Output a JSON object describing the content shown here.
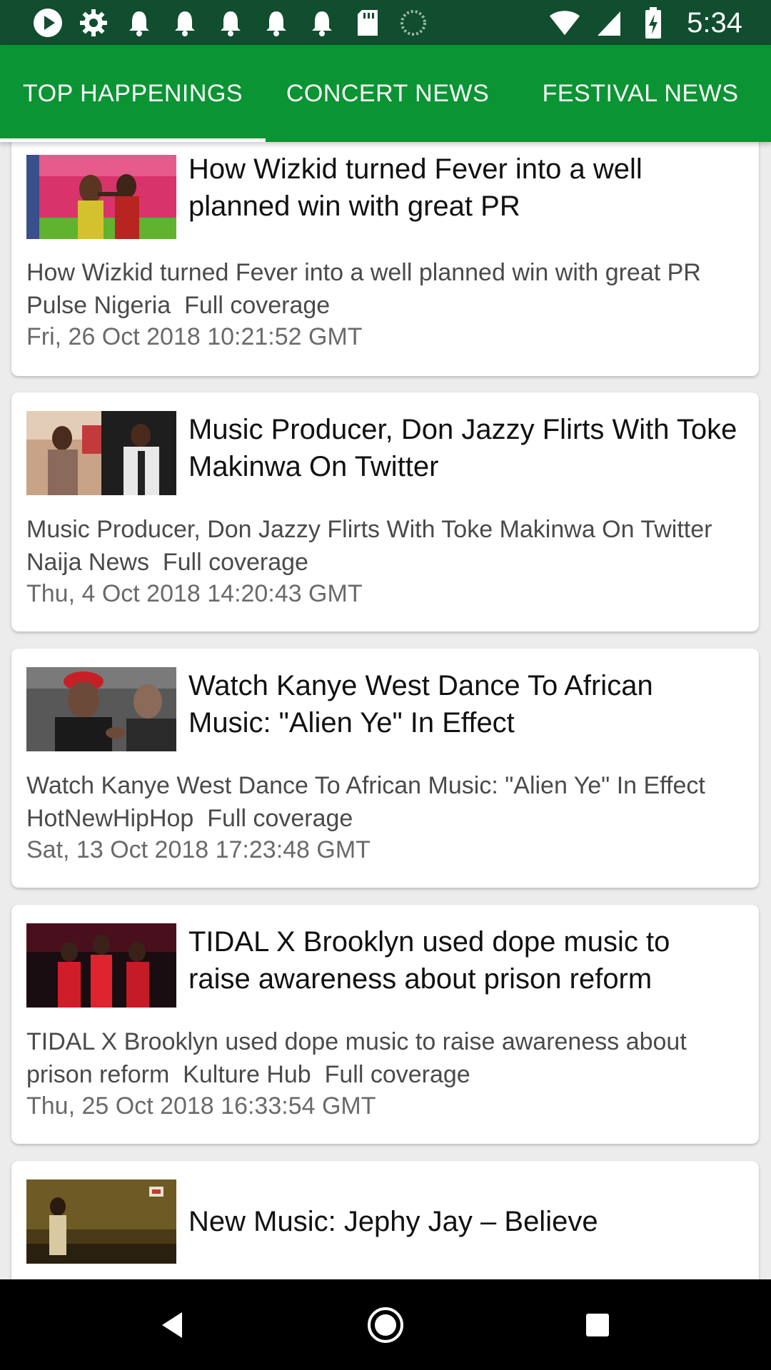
{
  "status_bar": {
    "time": "5:34",
    "icons": [
      "play-icon",
      "gear-icon",
      "bell-icon",
      "bell-icon",
      "bell-icon",
      "bell-icon",
      "bell-icon",
      "sd-card-icon",
      "loading-icon",
      "wifi-icon",
      "signal-icon",
      "battery-charging-icon"
    ]
  },
  "tabs": [
    {
      "label": "TOP HAPPENINGS",
      "selected": true
    },
    {
      "label": "CONCERT NEWS",
      "selected": false
    },
    {
      "label": "FESTIVAL NEWS",
      "selected": false
    }
  ],
  "articles": [
    {
      "title": "How Wizkid turned Fever into a well planned win with great PR",
      "description": "How Wizkid turned Fever into a well planned win with great PR  Pulse Nigeria  Full coverage",
      "date": "Fri, 26 Oct 2018 10:21:52 GMT",
      "thumbnail": "wizkid-photo"
    },
    {
      "title": "Music Producer, Don Jazzy Flirts With Toke Makinwa On Twitter",
      "description": "Music Producer, Don Jazzy Flirts With Toke Makinwa On Twitter  Naija News  Full coverage",
      "date": "Thu, 4 Oct 2018 14:20:43 GMT",
      "thumbnail": "don-jazzy-photo"
    },
    {
      "title": "Watch Kanye West Dance To African Music: \"Alien Ye\" In Effect",
      "description": "Watch Kanye West Dance To African Music: \"Alien Ye\" In Effect  HotNewHipHop  Full coverage",
      "date": "Sat, 13 Oct 2018 17:23:48 GMT",
      "thumbnail": "kanye-photo"
    },
    {
      "title": "TIDAL X Brooklyn used dope music to raise awareness about prison reform",
      "description": "TIDAL X Brooklyn used dope music to raise awareness about prison reform  Kulture Hub  Full coverage",
      "date": "Thu, 25 Oct 2018 16:33:54 GMT",
      "thumbnail": "tidal-photo"
    },
    {
      "title": "New Music: Jephy Jay – Believe",
      "description": "",
      "date": "",
      "thumbnail": "jephy-jay-photo"
    }
  ],
  "colors": {
    "status_bar": "#114d2f",
    "tab_bar": "#0a9433",
    "background": "#ececec"
  },
  "nav_bar": {
    "icons": [
      "back-icon",
      "home-icon",
      "recents-icon"
    ]
  }
}
